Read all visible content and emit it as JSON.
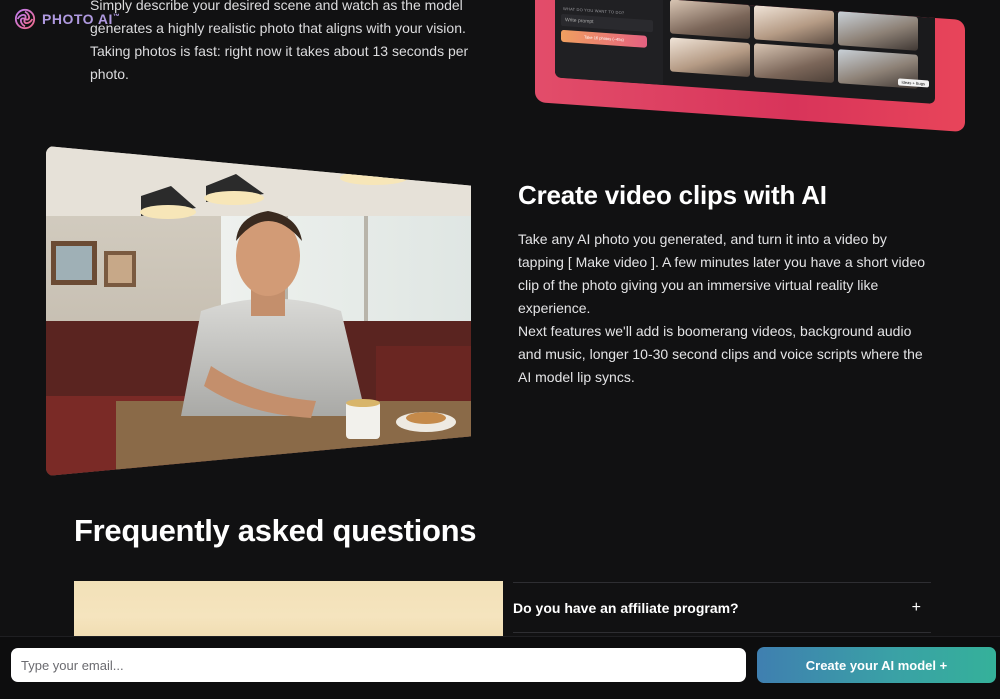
{
  "brand": {
    "name": "PHOTO AI",
    "tm": "™",
    "color": "#b09ae0"
  },
  "intro": {
    "text": "Simply describe your desired scene and watch as the model generates a highly realistic photo that aligns with your vision. Taking photos is fast: right now it takes about 13 seconds per photo."
  },
  "collage": {
    "prompt_label": "WHAT DO YOU WANT TO DO?",
    "prompt_placeholder": "Write prompt",
    "take_button": "Take 16 photos (~45s)",
    "tag": "Ideas + Bugs"
  },
  "video_section": {
    "title": "Create video clips with AI",
    "paragraph1": "Take any AI photo you generated, and turn it into a video by tapping [ Make video ]. A few minutes later you have a short video clip of the photo giving you an immersive virtual reality like experience.",
    "paragraph2": "Next features we'll add is boomerang videos, background audio and music, longer 10-30 second clips and voice scripts where the AI model lip syncs."
  },
  "faq": {
    "title": "Frequently asked questions",
    "items": [
      {
        "question": "Do you have an affiliate program?",
        "icon": "plus-icon"
      }
    ]
  },
  "signup": {
    "email_placeholder": "Type your email...",
    "cta_label": "Create your AI model +",
    "cta_colors": [
      "#3f7fb0",
      "#35b19a"
    ]
  }
}
